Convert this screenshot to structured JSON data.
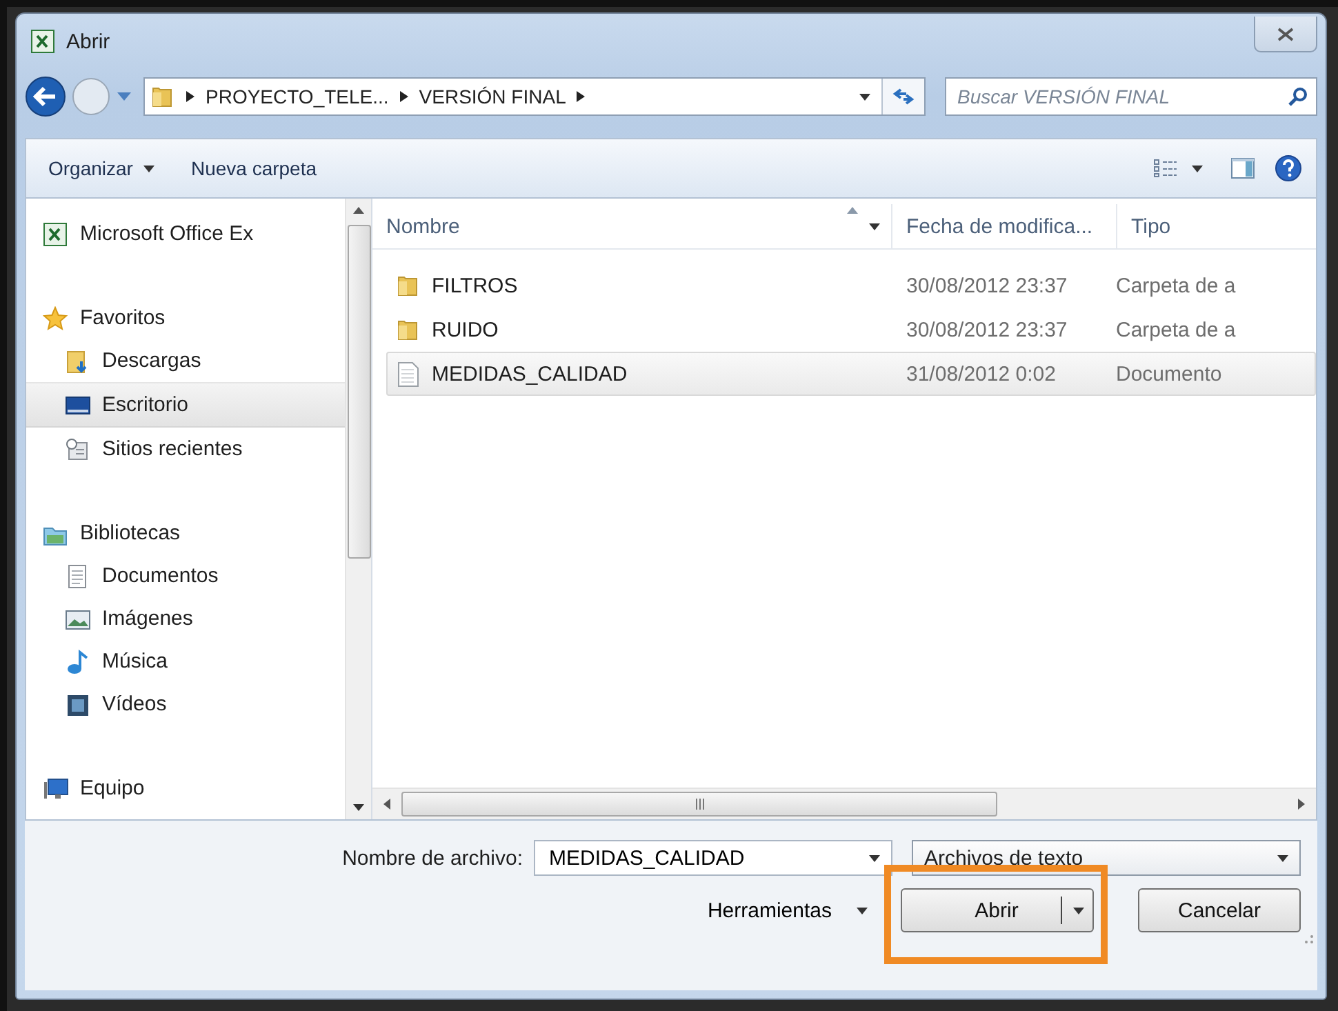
{
  "window": {
    "title": "Abrir"
  },
  "address": {
    "segments": [
      "PROYECTO_TELE...",
      "VERSIÓN FINAL"
    ]
  },
  "search": {
    "placeholder": "Buscar VERSIÓN FINAL"
  },
  "toolbar": {
    "buttons": [
      {
        "label": "Organizar",
        "dropdown": true
      },
      {
        "label": "Nueva carpeta",
        "dropdown": false
      }
    ]
  },
  "sidebar": {
    "items": [
      {
        "label": "Microsoft Office Ex",
        "selected": false
      },
      {
        "label": "Favoritos",
        "selected": false,
        "children": [
          {
            "label": "Descargas",
            "selected": false
          },
          {
            "label": "Escritorio",
            "selected": true
          },
          {
            "label": "Sitios recientes",
            "selected": false
          }
        ]
      },
      {
        "label": "Bibliotecas",
        "selected": false,
        "children": [
          {
            "label": "Documentos",
            "selected": false
          },
          {
            "label": "Imágenes",
            "selected": false
          },
          {
            "label": "Música",
            "selected": false
          },
          {
            "label": "Vídeos",
            "selected": false
          }
        ]
      },
      {
        "label": "Equipo",
        "selected": false
      }
    ]
  },
  "file_list": {
    "columns": [
      "Nombre",
      "Fecha de modifica...",
      "Tipo"
    ],
    "rows": [
      {
        "name": "FILTROS",
        "kind": "folder",
        "date": "30/08/2012 23:37",
        "type": "Carpeta de a",
        "selected": false
      },
      {
        "name": "RUIDO",
        "kind": "folder",
        "date": "30/08/2012 23:37",
        "type": "Carpeta de a",
        "selected": false
      },
      {
        "name": "MEDIDAS_CALIDAD",
        "kind": "file",
        "date": "31/08/2012 0:02",
        "type": "Documento",
        "selected": true
      }
    ]
  },
  "filename": {
    "label": "Nombre de archivo:",
    "value": "MEDIDAS_CALIDAD"
  },
  "filetype": {
    "value": "Archivos de texto"
  },
  "tools": {
    "label": "Herramientas"
  },
  "buttons": [
    {
      "label": "Abrir",
      "kind": "split",
      "highlighted": true
    },
    {
      "label": "Cancelar",
      "kind": "plain",
      "highlighted": false
    }
  ]
}
